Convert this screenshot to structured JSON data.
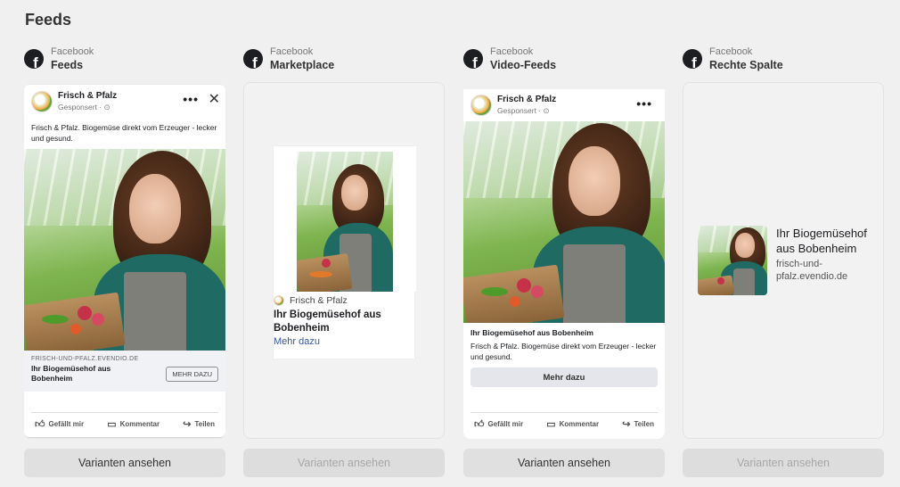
{
  "section_title": "Feeds",
  "placements": [
    {
      "provider": "Facebook",
      "name": "Feeds",
      "variants_label": "Varianten ansehen",
      "variants_enabled": true
    },
    {
      "provider": "Facebook",
      "name": "Marketplace",
      "variants_label": "Varianten ansehen",
      "variants_enabled": false
    },
    {
      "provider": "Facebook",
      "name": "Video-Feeds",
      "variants_label": "Varianten ansehen",
      "variants_enabled": true
    },
    {
      "provider": "Facebook",
      "name": "Rechte Spalte",
      "variants_label": "Varianten ansehen",
      "variants_enabled": false
    }
  ],
  "ad": {
    "page_name": "Frisch & Pfalz",
    "sponsored": "Gesponsert · ⊙",
    "primary_text": "Frisch & Pfalz. Biogemüse direkt vom Erzeuger - lecker und gesund.",
    "domain_upper": "FRISCH-UND-PFALZ.EVENDIO.DE",
    "headline": "Ihr Biogemüsehof aus Bobenheim",
    "cta_upper": "MEHR DAZU",
    "cta": "Mehr dazu",
    "domain_lower": "frisch-und-pfalz.evendio.de"
  },
  "reactions": {
    "like": "Gefällt mir",
    "comment": "Kommentar",
    "share": "Teilen"
  },
  "icons": {
    "facebook": "facebook-logo-icon",
    "more": "more-dots-icon",
    "close": "close-icon",
    "like": "thumbs-up-icon",
    "comment": "comment-icon",
    "share": "share-icon"
  }
}
